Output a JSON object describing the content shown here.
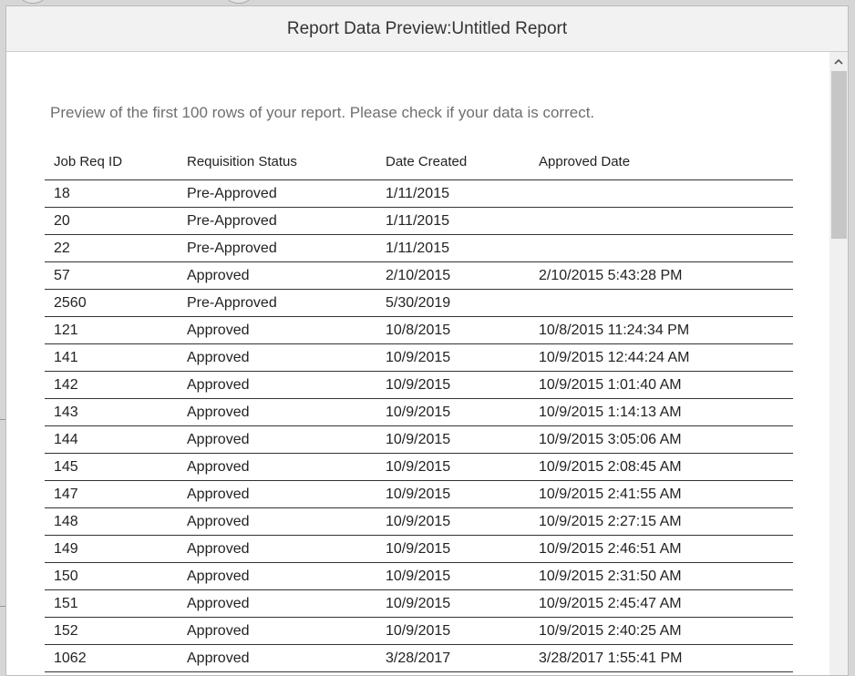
{
  "dialog": {
    "title": "Report Data Preview:Untitled Report",
    "intro": "Preview of the first 100 rows of your report. Please check if your data is correct."
  },
  "table": {
    "headers": [
      "Job Req ID",
      "Requisition Status",
      "Date Created",
      "Approved Date"
    ],
    "rows": [
      [
        "18",
        "Pre-Approved",
        "1/11/2015",
        ""
      ],
      [
        "20",
        "Pre-Approved",
        "1/11/2015",
        ""
      ],
      [
        "22",
        "Pre-Approved",
        "1/11/2015",
        ""
      ],
      [
        "57",
        "Approved",
        "2/10/2015",
        "2/10/2015 5:43:28 PM"
      ],
      [
        "2560",
        "Pre-Approved",
        "5/30/2019",
        ""
      ],
      [
        "121",
        "Approved",
        "10/8/2015",
        "10/8/2015 11:24:34 PM"
      ],
      [
        "141",
        "Approved",
        "10/9/2015",
        "10/9/2015 12:44:24 AM"
      ],
      [
        "142",
        "Approved",
        "10/9/2015",
        "10/9/2015 1:01:40 AM"
      ],
      [
        "143",
        "Approved",
        "10/9/2015",
        "10/9/2015 1:14:13 AM"
      ],
      [
        "144",
        "Approved",
        "10/9/2015",
        "10/9/2015 3:05:06 AM"
      ],
      [
        "145",
        "Approved",
        "10/9/2015",
        "10/9/2015 2:08:45 AM"
      ],
      [
        "147",
        "Approved",
        "10/9/2015",
        "10/9/2015 2:41:55 AM"
      ],
      [
        "148",
        "Approved",
        "10/9/2015",
        "10/9/2015 2:27:15 AM"
      ],
      [
        "149",
        "Approved",
        "10/9/2015",
        "10/9/2015 2:46:51 AM"
      ],
      [
        "150",
        "Approved",
        "10/9/2015",
        "10/9/2015 2:31:50 AM"
      ],
      [
        "151",
        "Approved",
        "10/9/2015",
        "10/9/2015 2:45:47 AM"
      ],
      [
        "152",
        "Approved",
        "10/9/2015",
        "10/9/2015 2:40:25 AM"
      ],
      [
        "1062",
        "Approved",
        "3/28/2017",
        "3/28/2017 1:55:41 PM"
      ]
    ]
  },
  "scrollbar": {
    "up_icon": "chevron-up-icon"
  }
}
